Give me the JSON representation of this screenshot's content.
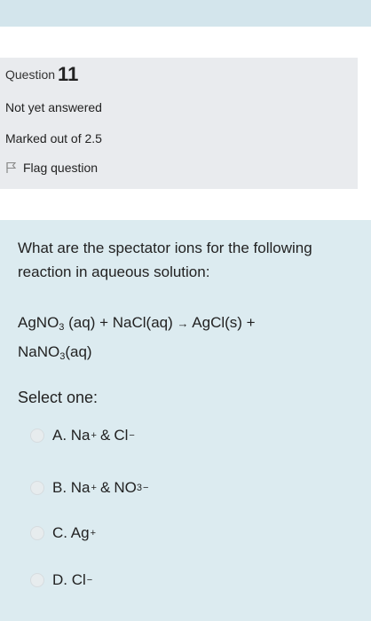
{
  "info": {
    "question_label": "Question",
    "question_number": "11",
    "status": "Not yet answered",
    "marked": "Marked out of 2.5",
    "flag_label": "Flag question"
  },
  "question": {
    "text": "What are the spectator ions for the following reaction in aqueous solution:",
    "reaction": {
      "r1_a": "AgNO",
      "r1_sub": "3",
      "r1_b": " (aq) + NaCl(aq) ",
      "arrow": "→",
      "r1_c": " AgCl(s) +",
      "r2_a": "NaNO",
      "r2_sub": "3",
      "r2_b": "(aq)"
    },
    "select_label": "Select one:"
  },
  "options": [
    {
      "label": "A. Na",
      "sup1": "+",
      "amp": "&",
      "rest": "Cl",
      "sup2": "−"
    },
    {
      "label": "B. Na",
      "sup1": "+",
      "amp": "&",
      "rest": "NO",
      "sub": "3",
      "sup2": "−"
    },
    {
      "label": "C. Ag",
      "sup1": "+"
    },
    {
      "label": "D. Cl",
      "sup1": "−"
    }
  ]
}
